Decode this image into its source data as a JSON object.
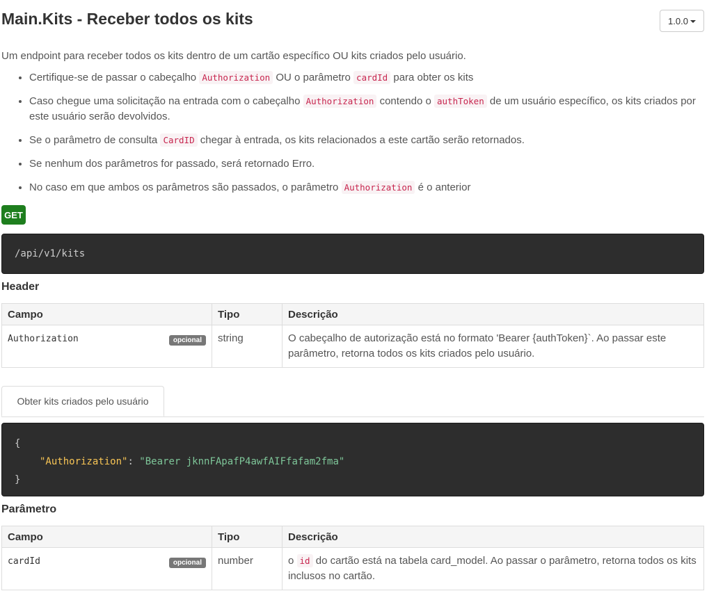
{
  "header": {
    "title": "Main.Kits - Receber todos os kits",
    "version": "1.0.0"
  },
  "intro": "Um endpoint para receber todos os kits dentro de um cartão específico OU kits criados pelo usuário.",
  "bullets": [
    {
      "t1": "Certifique-se de passar o cabeçalho ",
      "c1": "Authorization",
      "t2": " OU o parâmetro ",
      "c2": "cardId",
      "t3": " para obter os kits"
    },
    {
      "t1": "Caso chegue uma solicitação na entrada com o cabeçalho ",
      "c1": "Authorization",
      "t2": " contendo o ",
      "c2": "authToken",
      "t3": " de um usuário específico, os kits criados por este usuário serão devolvidos."
    },
    {
      "t1": "Se o parâmetro de consulta ",
      "c1": "CardID",
      "t2": " chegar à entrada, os kits relacionados a este cartão serão retornados."
    },
    {
      "t1": "Se nenhum dos parâmetros for passado, será retornado Erro."
    },
    {
      "t1": "No caso em que ambos os parâmetros são passados, o parâmetro ",
      "c1": "Authorization",
      "t2": " é o anterior"
    }
  ],
  "method": "GET",
  "endpoint": "/api/v1/kits",
  "header_section": {
    "title": "Header",
    "columns": {
      "field": "Campo",
      "type": "Tipo",
      "description": "Descrição"
    },
    "rows": [
      {
        "field": "Authorization",
        "badge": "opcional",
        "type": "string",
        "description": "O cabeçalho de autorização está no formato 'Bearer {authToken}`. Ao passar este parâmetro, retorna todos os kits criados pelo usuário."
      }
    ]
  },
  "example": {
    "tab_label": "Obter kits criados pelo usuário",
    "open_brace": "{",
    "key": "\"Authorization\"",
    "colon": ": ",
    "value": "\"Bearer jknnFApafP4awfAIFfafam2fma\"",
    "close_brace": "}"
  },
  "param_section": {
    "title": "Parâmetro",
    "columns": {
      "field": "Campo",
      "type": "Tipo",
      "description": "Descrição"
    },
    "rows": [
      {
        "field": "cardId",
        "badge": "opcional",
        "type": "number",
        "desc_pre": "o ",
        "desc_code": "id",
        "desc_post": " do cartão está na tabela card_model. Ao passar o parâmetro, retorna todos os kits inclusos no cartão."
      }
    ]
  },
  "colors": {
    "get_badge": "#1e7e1e",
    "code_bg": "#2d2d2d",
    "inline_code": "#c7254e",
    "json_key": "#f8c555",
    "json_string": "#7ec699"
  }
}
